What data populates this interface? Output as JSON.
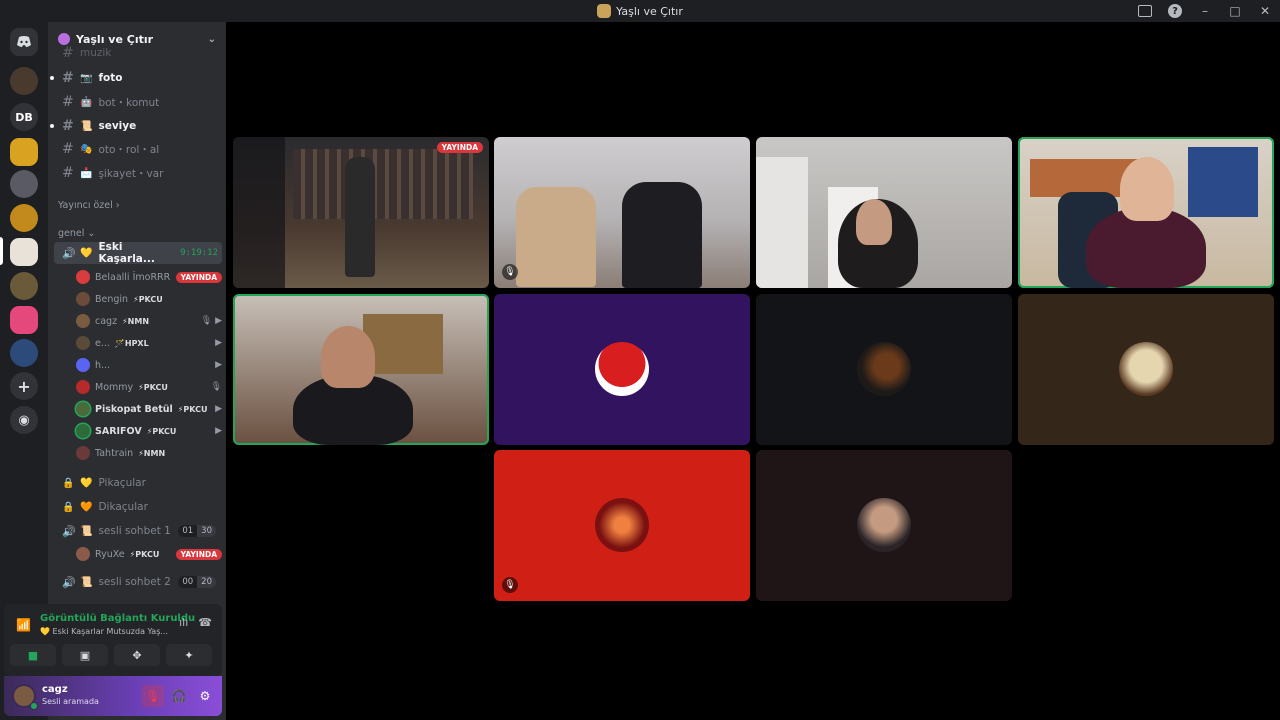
{
  "window": {
    "title": "Yaşlı ve Çıtır",
    "minimize": "–",
    "maximize": "□",
    "close": "✕",
    "help": "?"
  },
  "guilds": {
    "db_label": "DB",
    "add_label": "+",
    "discover_label": "◉"
  },
  "server": {
    "name": "Yaşlı ve Çıtır",
    "chevron": "⌄"
  },
  "channels": {
    "top_partial": "muzik",
    "text": [
      {
        "emoji": "📷",
        "label": "foto",
        "unread": true
      },
      {
        "emoji": "🤖",
        "label": "bot・komut",
        "unread": false
      },
      {
        "emoji": "📜",
        "label": "seviye",
        "unread": true
      },
      {
        "emoji": "🎭",
        "label": "oto・rol・al",
        "unread": false
      },
      {
        "emoji": "📩",
        "label": "şikayet・var",
        "unread": false
      }
    ],
    "category_streamer": "Yayıncı özel",
    "category_general": "genel",
    "active_voice": {
      "emoji": "💛",
      "label": "Eski Kaşarla...",
      "timer": "9:19:12"
    },
    "members": [
      {
        "name": "Belaalli İmoRRR",
        "tag": "",
        "live": "YAYINDA",
        "bright": false,
        "color": "#d83c3e"
      },
      {
        "name": "Bengin",
        "tag": "⚡PKCU",
        "live": "",
        "bright": false,
        "color": "#6b4c3b"
      },
      {
        "name": "cagz",
        "tag": "⚡NMN",
        "live": "",
        "bright": false,
        "color": "#7a5a40",
        "icons": "🎙 ▶"
      },
      {
        "name": "e...",
        "tag": "🪄HPXL",
        "live": "",
        "bright": false,
        "color": "#5a4a3a",
        "icons": "▶"
      },
      {
        "name": "h...",
        "tag": "",
        "live": "",
        "bright": false,
        "color": "#5865f2",
        "icons": "▶"
      },
      {
        "name": "Mommy",
        "tag": "⚡PKCU",
        "live": "",
        "bright": false,
        "color": "#b52a2a",
        "icons": "🎙"
      },
      {
        "name": "Piskopat Betül",
        "tag": "⚡PKCU",
        "live": "",
        "bright": true,
        "color": "#4a6a3a",
        "icons": "▶"
      },
      {
        "name": "SARIFOV",
        "tag": "⚡PKCU",
        "live": "",
        "bright": true,
        "color": "#2e6b3a",
        "icons": "▶"
      },
      {
        "name": "Tahtrain",
        "tag": "⚡NMN",
        "live": "",
        "bright": false,
        "color": "#6a3a3a"
      }
    ],
    "locked": [
      {
        "emoji": "💛",
        "label": "Pikaçular"
      },
      {
        "emoji": "🧡",
        "label": "Dikaçular"
      }
    ],
    "sesli1": {
      "emoji": "📜",
      "label": "sesli sohbet 1",
      "c1": "01",
      "c2": "30"
    },
    "sesli1_member": {
      "name": "RyuXe",
      "tag": "⚡PKCU",
      "live": "YAYINDA"
    },
    "sesli2": {
      "emoji": "📜",
      "label": "sesli sohbet 2",
      "c1": "00",
      "c2": "20"
    }
  },
  "voice_panel": {
    "status": "Görüntülü Bağlantı Kuruldu",
    "subtitle": "💛 Eski Kaşarlar Mutsuzda Yaş...",
    "signal_icon": "📶"
  },
  "user_panel": {
    "name": "cagz",
    "status": "Sesli aramada"
  },
  "stage": {
    "live_badge": "YAYINDA"
  },
  "colors": {
    "accent_green": "#23a55a",
    "live_red": "#da373c",
    "tile_purple": "#32135f",
    "tile_red": "#d01f14",
    "tile_brown": "#35261a"
  }
}
